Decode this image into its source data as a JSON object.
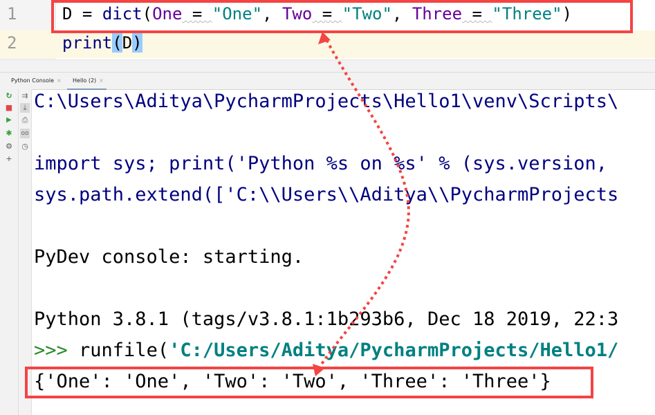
{
  "editor": {
    "lines": [
      {
        "number": "1",
        "tokens": {
          "var": "D",
          "eq": " = ",
          "func": "dict",
          "open": "(",
          "p1": "One",
          "eq1": " = ",
          "s1": "\"One\"",
          "c1": ", ",
          "p2": "Two",
          "eq2": " = ",
          "s2": "\"Two\"",
          "c2": ", ",
          "p3": "Three",
          "eq3": " = ",
          "s3": "\"Three\"",
          "close": ")"
        }
      },
      {
        "number": "2",
        "tokens": {
          "func": "print",
          "open": "(",
          "arg": "D",
          "close": ")"
        }
      }
    ]
  },
  "tool_window": {
    "tabs": [
      {
        "label": "Python Console",
        "close": "×",
        "active": false
      },
      {
        "label": "Hello (2)",
        "close": "×",
        "active": true
      }
    ]
  },
  "toolbar_left": [
    {
      "icon": "rerun-icon",
      "glyph": "↻",
      "color": "#2e9a3a"
    },
    {
      "icon": "stop-icon",
      "glyph": "■",
      "color": "#e04848"
    },
    {
      "icon": "run-icon",
      "glyph": "▶",
      "color": "#3a9e3a"
    },
    {
      "icon": "debug-icon",
      "glyph": "✱",
      "color": "#3a9e3a"
    },
    {
      "icon": "settings-icon",
      "glyph": "⚙",
      "color": "#555555"
    },
    {
      "icon": "add-icon",
      "glyph": "+",
      "color": "#555555"
    }
  ],
  "toolbar_right": [
    {
      "icon": "soft-wrap-icon",
      "glyph": "⇉",
      "selected": false
    },
    {
      "icon": "scroll-to-end-icon",
      "glyph": "⤓",
      "selected": true
    },
    {
      "icon": "print-icon",
      "glyph": "⎙",
      "selected": false
    },
    {
      "icon": "show-variables-icon",
      "glyph": "oo",
      "selected": true
    },
    {
      "icon": "history-icon",
      "glyph": "◷",
      "selected": false
    }
  ],
  "console": {
    "path_line": "C:\\Users\\Aditya\\PycharmProjects\\Hello1\\venv\\Scripts\\",
    "import_line": "import sys; print('Python %s on %s' % (sys.version, ",
    "syspath_line": "sys.path.extend(['C:\\\\Users\\\\Aditya\\\\PycharmProjects",
    "pydev_line": "PyDev console: starting.",
    "python_version_line": "Python 3.8.1 (tags/v3.8.1:1b293b6, Dec 18 2019, 22:3",
    "prompt": ">>> ",
    "runfile_call": "runfile(",
    "runfile_arg": "'C:/Users/Aditya/PycharmProjects/Hello1/",
    "output_line": "{'One': 'One', 'Two': 'Two', 'Three': 'Three'}"
  },
  "annotation": {
    "color": "#f44444"
  }
}
